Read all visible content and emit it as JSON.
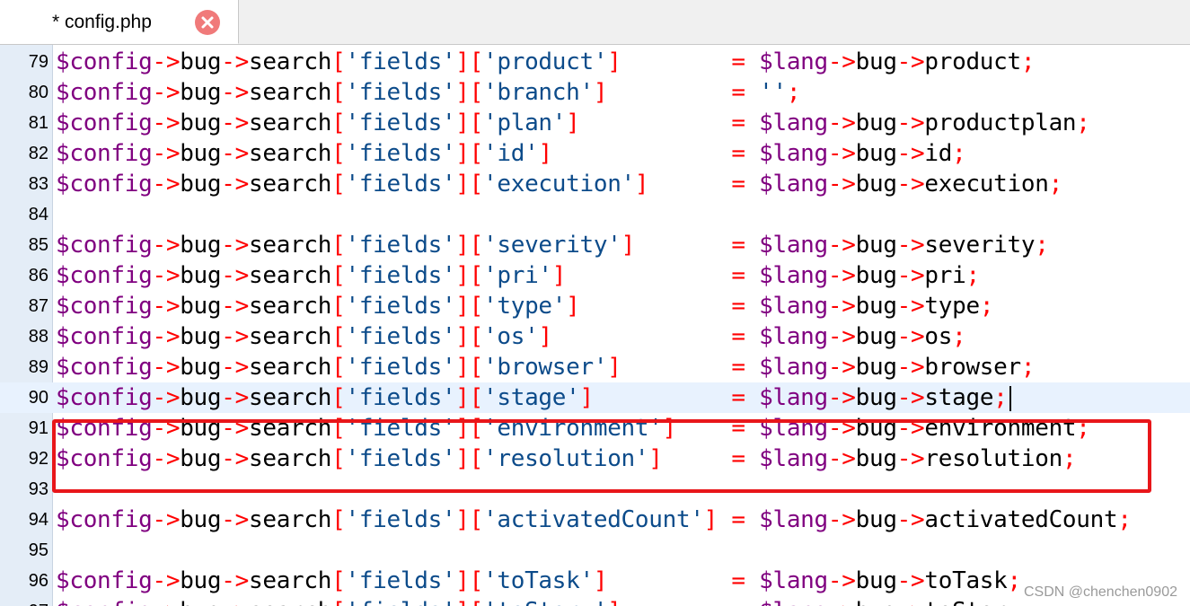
{
  "tab": {
    "title": "* config.php"
  },
  "lines": [
    {
      "n": "79",
      "name": "product",
      "str": "'product'",
      "pad": "        ",
      "rhs": "product",
      "end": ";",
      "blankAfter": false
    },
    {
      "n": "80",
      "name": "branch",
      "str": "'branch'",
      "pad": "         ",
      "rhs": null,
      "rhsLiteral": "''",
      "end": ";"
    },
    {
      "n": "81",
      "name": "plan",
      "str": "'plan'",
      "pad": "           ",
      "rhs": "productplan",
      "end": ";"
    },
    {
      "n": "82",
      "name": "id",
      "str": "'id'",
      "pad": "             ",
      "rhs": "id",
      "end": ";"
    },
    {
      "n": "83",
      "name": "execution",
      "str": "'execution'",
      "pad": "      ",
      "rhs": "execution",
      "end": ";"
    },
    {
      "n": "84",
      "blank": true
    },
    {
      "n": "85",
      "name": "severity",
      "str": "'severity'",
      "pad": "       ",
      "rhs": "severity",
      "end": ";"
    },
    {
      "n": "86",
      "name": "pri",
      "str": "'pri'",
      "pad": "            ",
      "rhs": "pri",
      "end": ";"
    },
    {
      "n": "87",
      "name": "type",
      "str": "'type'",
      "pad": "           ",
      "rhs": "type",
      "end": ";"
    },
    {
      "n": "88",
      "name": "os",
      "str": "'os'",
      "pad": "             ",
      "rhs": "os",
      "end": ";"
    },
    {
      "n": "89",
      "name": "browser",
      "str": "'browser'",
      "pad": "        ",
      "rhs": "browser",
      "end": ";"
    },
    {
      "n": "90",
      "name": "stage",
      "str": "'stage'",
      "pad": "          ",
      "rhs": "stage",
      "end": ";",
      "current": true
    },
    {
      "n": "91",
      "name": "environment",
      "str": "'environment'",
      "pad": "    ",
      "rhs": "environment",
      "end": ";"
    },
    {
      "n": "92",
      "name": "resolution",
      "str": "'resolution'",
      "pad": "     ",
      "rhs": "resolution",
      "end": ";"
    },
    {
      "n": "93",
      "blank": true
    },
    {
      "n": "94",
      "name": "activatedCount",
      "str": "'activatedCount'",
      "pad": " ",
      "rhs": "activatedCount",
      "end": ";"
    },
    {
      "n": "95",
      "blank": true
    },
    {
      "n": "96",
      "name": "toTask",
      "str": "'toTask'",
      "pad": "         ",
      "rhs": "toTask",
      "end": ";"
    },
    {
      "n": "97",
      "name": "toStory",
      "str": "'toStory'",
      "pad": "        ",
      "rhs": "toStory",
      "end": ";"
    }
  ],
  "tokens": {
    "config": "$config",
    "arrow": "->",
    "bug": "bug",
    "search": "search",
    "lbr": "[",
    "rbr": "]",
    "fields": "'fields'",
    "eq": "=",
    "lang": "$lang"
  },
  "colors": {
    "variable": "#800080",
    "operator": "#ff0000",
    "identifier": "#000000",
    "string": "#0c4b8a",
    "gutter": "#e4edf7",
    "current_line": "#e8f2fe",
    "highlight_box": "#e8161a"
  },
  "watermark": "CSDN @chenchen0902"
}
